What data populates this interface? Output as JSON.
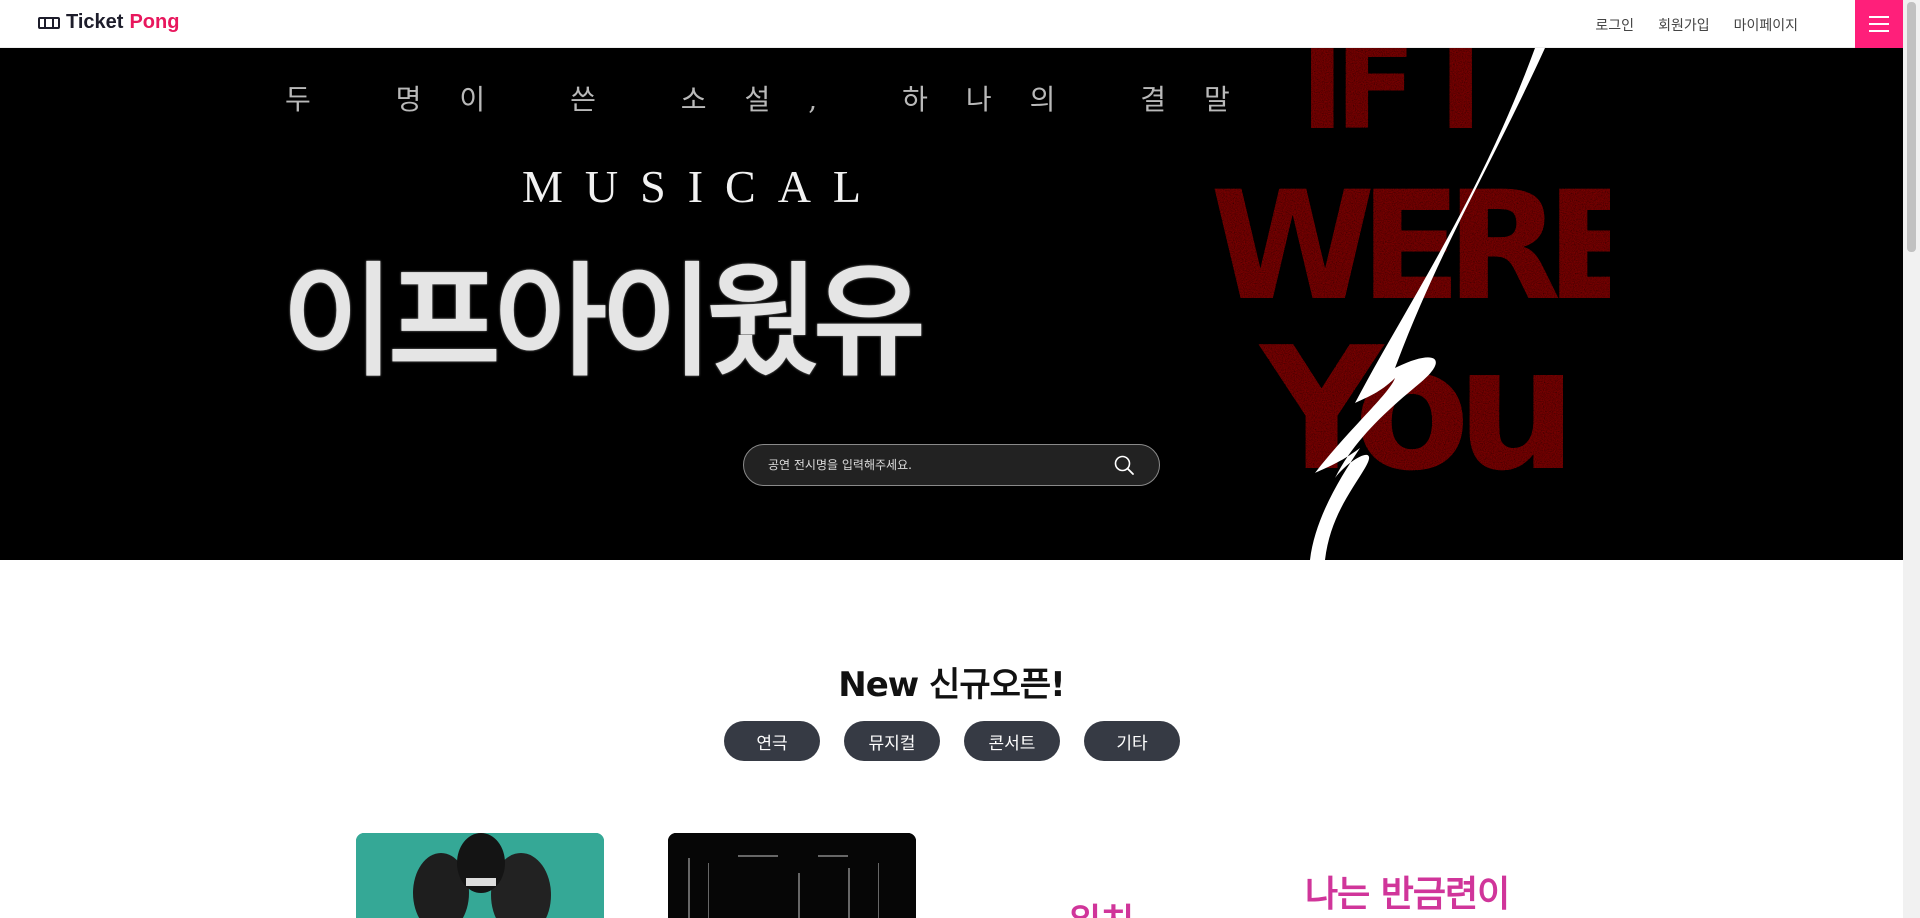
{
  "header": {
    "logo_text_1": "Ticket",
    "logo_text_2": "Pong",
    "nav": [
      "로그인",
      "회원가입",
      "마이페이지"
    ],
    "menu_icon": "hamburger-icon"
  },
  "hero": {
    "tagline": "두 명이 쓴 소설, 하나의 결말",
    "category": "MUSICAL",
    "title": "이프아이웠유",
    "poster_text": "IF I WERE YOU",
    "search": {
      "placeholder": "공연 전시명을 입력해주세요.",
      "icon": "search-icon"
    }
  },
  "new_section": {
    "title": "New 신규오픈!",
    "tabs": [
      "연극",
      "뮤지컬",
      "콘서트",
      "기타"
    ]
  },
  "cards": [
    {
      "text": ""
    },
    {
      "text": ""
    },
    {
      "text": "워치"
    },
    {
      "text": "나는 반금련이"
    }
  ],
  "colors": {
    "brand_pink": "#ff1f7a",
    "logo_pink": "#e8175d",
    "tab_bg": "#363a44",
    "hero_bg": "#000000",
    "poster_red": "#8a1b12"
  }
}
